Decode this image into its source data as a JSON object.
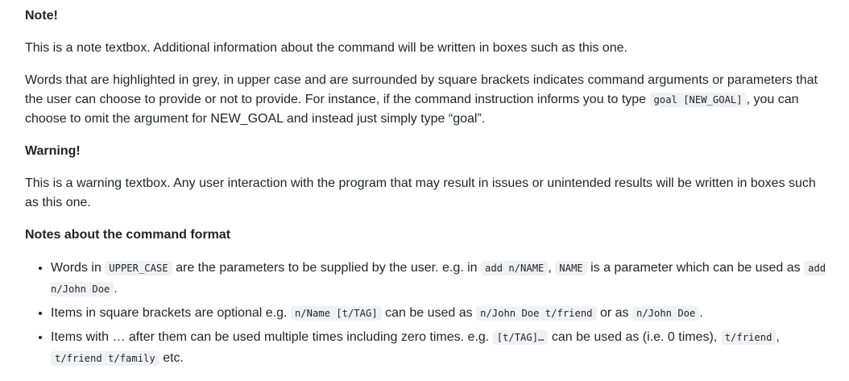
{
  "note": {
    "heading": "Note!",
    "para1": "This is a note textbox. Additional information about the command will be written in boxes such as this one.",
    "para2_a": "Words that are highlighted in grey, in upper case and are surrounded by square brackets indicates command arguments or parameters that the user can choose to provide or not to provide. For instance, if the command instruction informs you to type ",
    "para2_code": "goal [NEW_GOAL]",
    "para2_b": ", you can choose to omit the argument for NEW_GOAL and instead just simply type “goal”."
  },
  "warning": {
    "heading": "Warning!",
    "para": "This is a warning textbox. Any user interaction with the program that may result in issues or unintended results will be written in boxes such as this one."
  },
  "format": {
    "heading": "Notes about the command format",
    "item1": {
      "t1": "Words in ",
      "c1": "UPPER_CASE",
      "t2": " are the parameters to be supplied by the user. e.g. in ",
      "c2": "add n/NAME",
      "t3": ", ",
      "c3": "NAME",
      "t4": " is a parameter which can be used as ",
      "c4": "add n/John Doe",
      "t5": "."
    },
    "item2": {
      "t1": "Items in square brackets are optional e.g. ",
      "c1": "n/Name [t/TAG]",
      "t2": " can be used as ",
      "c2": "n/John Doe t/friend",
      "t3": " or as ",
      "c3": "n/John Doe",
      "t4": "."
    },
    "item3": {
      "t1": "Items with … after them can be used multiple times including zero times. e.g. ",
      "c1": "[t/TAG]…",
      "t2": " can be used as (i.e. 0 times), ",
      "c2": "t/friend",
      "t3": ", ",
      "c3": "t/friend t/family",
      "t4": " etc."
    }
  }
}
